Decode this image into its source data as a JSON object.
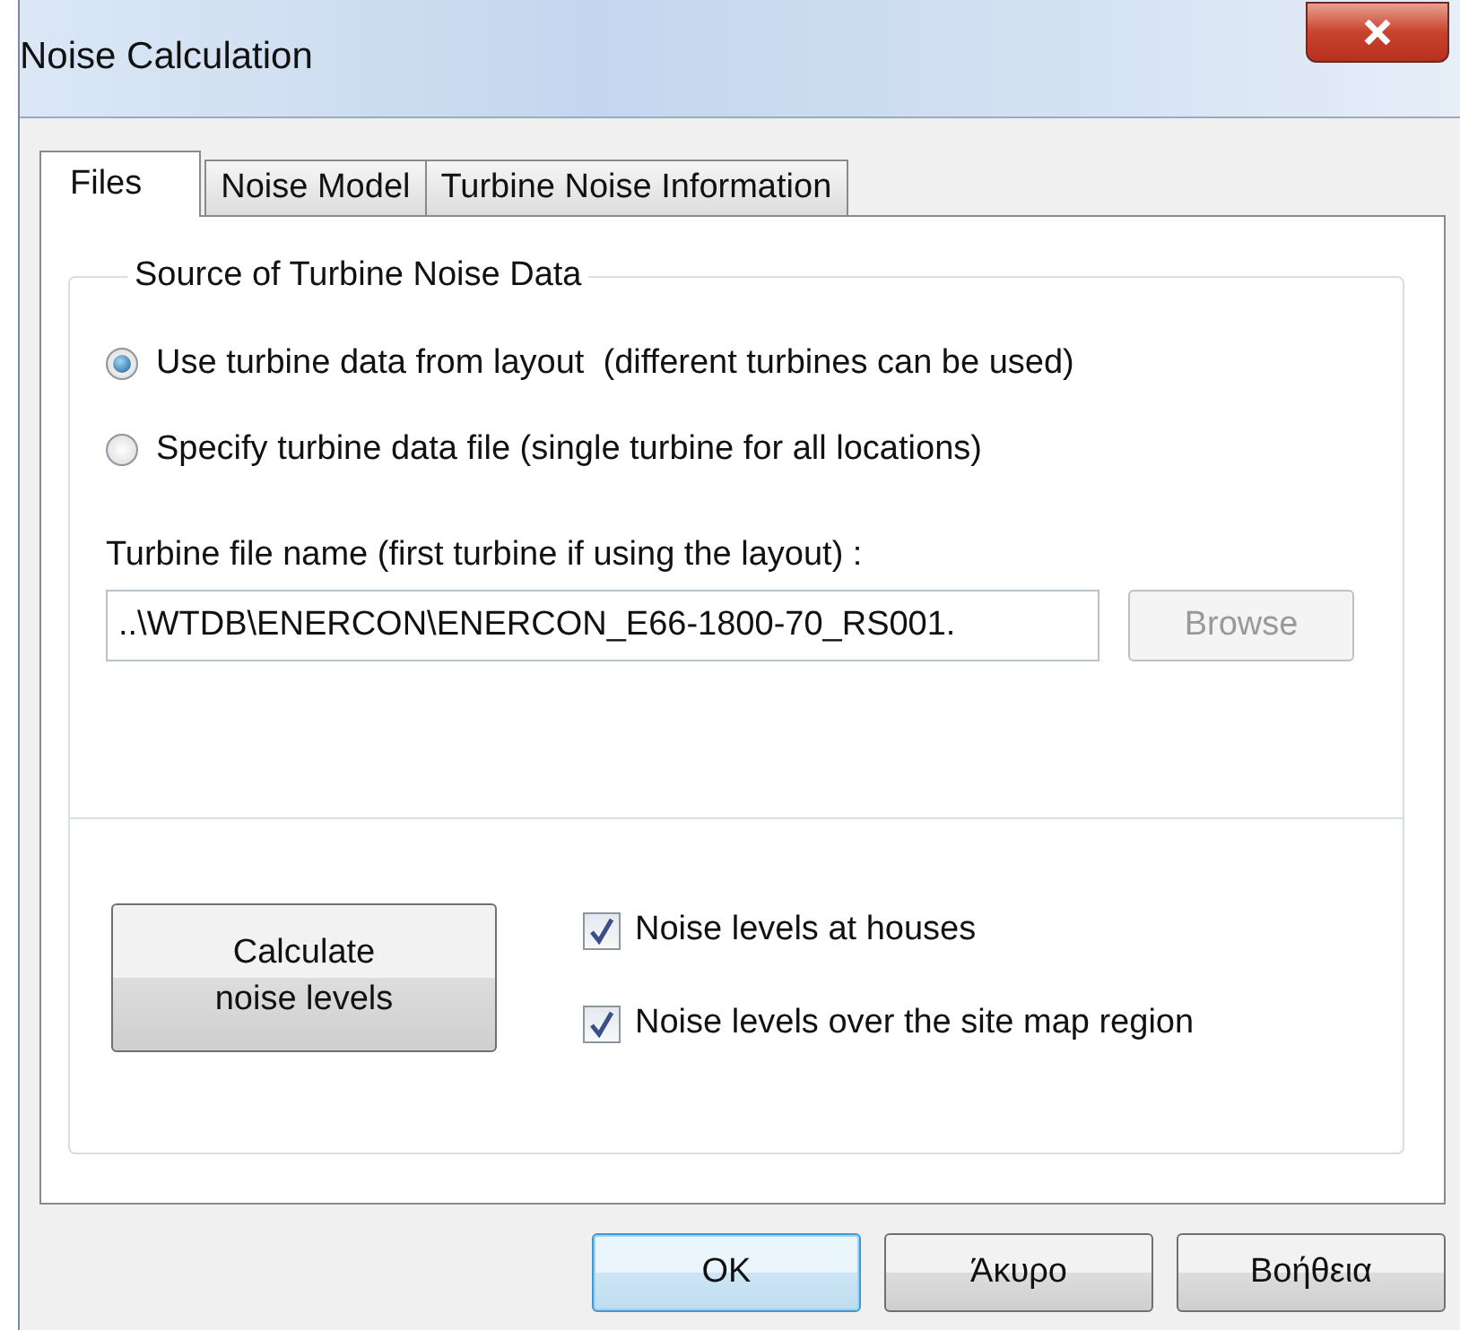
{
  "window": {
    "title": "Noise Calculation"
  },
  "tabs": [
    {
      "label": "Files",
      "selected": true
    },
    {
      "label": "Noise Model",
      "selected": false
    },
    {
      "label": "Turbine Noise Information",
      "selected": false
    }
  ],
  "source_group": {
    "title": "Source of Turbine Noise Data",
    "options": [
      {
        "label": "Use turbine data from layout  (different turbines can be used)",
        "selected": true
      },
      {
        "label": "Specify turbine data file (single turbine for all locations)",
        "selected": false
      }
    ]
  },
  "file_field": {
    "label": "Turbine file name (first turbine if using the layout) :",
    "value": "..\\WTDB\\ENERCON\\ENERCON_E66-1800-70_RS001.",
    "browse_button": {
      "label": "Browse",
      "disabled": true
    }
  },
  "calculate_button": {
    "label": "Calculate\nnoise levels"
  },
  "outputs": [
    {
      "label": "Noise levels at houses",
      "checked": true
    },
    {
      "label": "Noise levels over the site map region",
      "checked": true
    }
  ],
  "buttons": [
    {
      "label": "OK",
      "default": true
    },
    {
      "label": "Άκυρο",
      "default": false
    },
    {
      "label": "Βοήθεια",
      "default": false
    }
  ]
}
